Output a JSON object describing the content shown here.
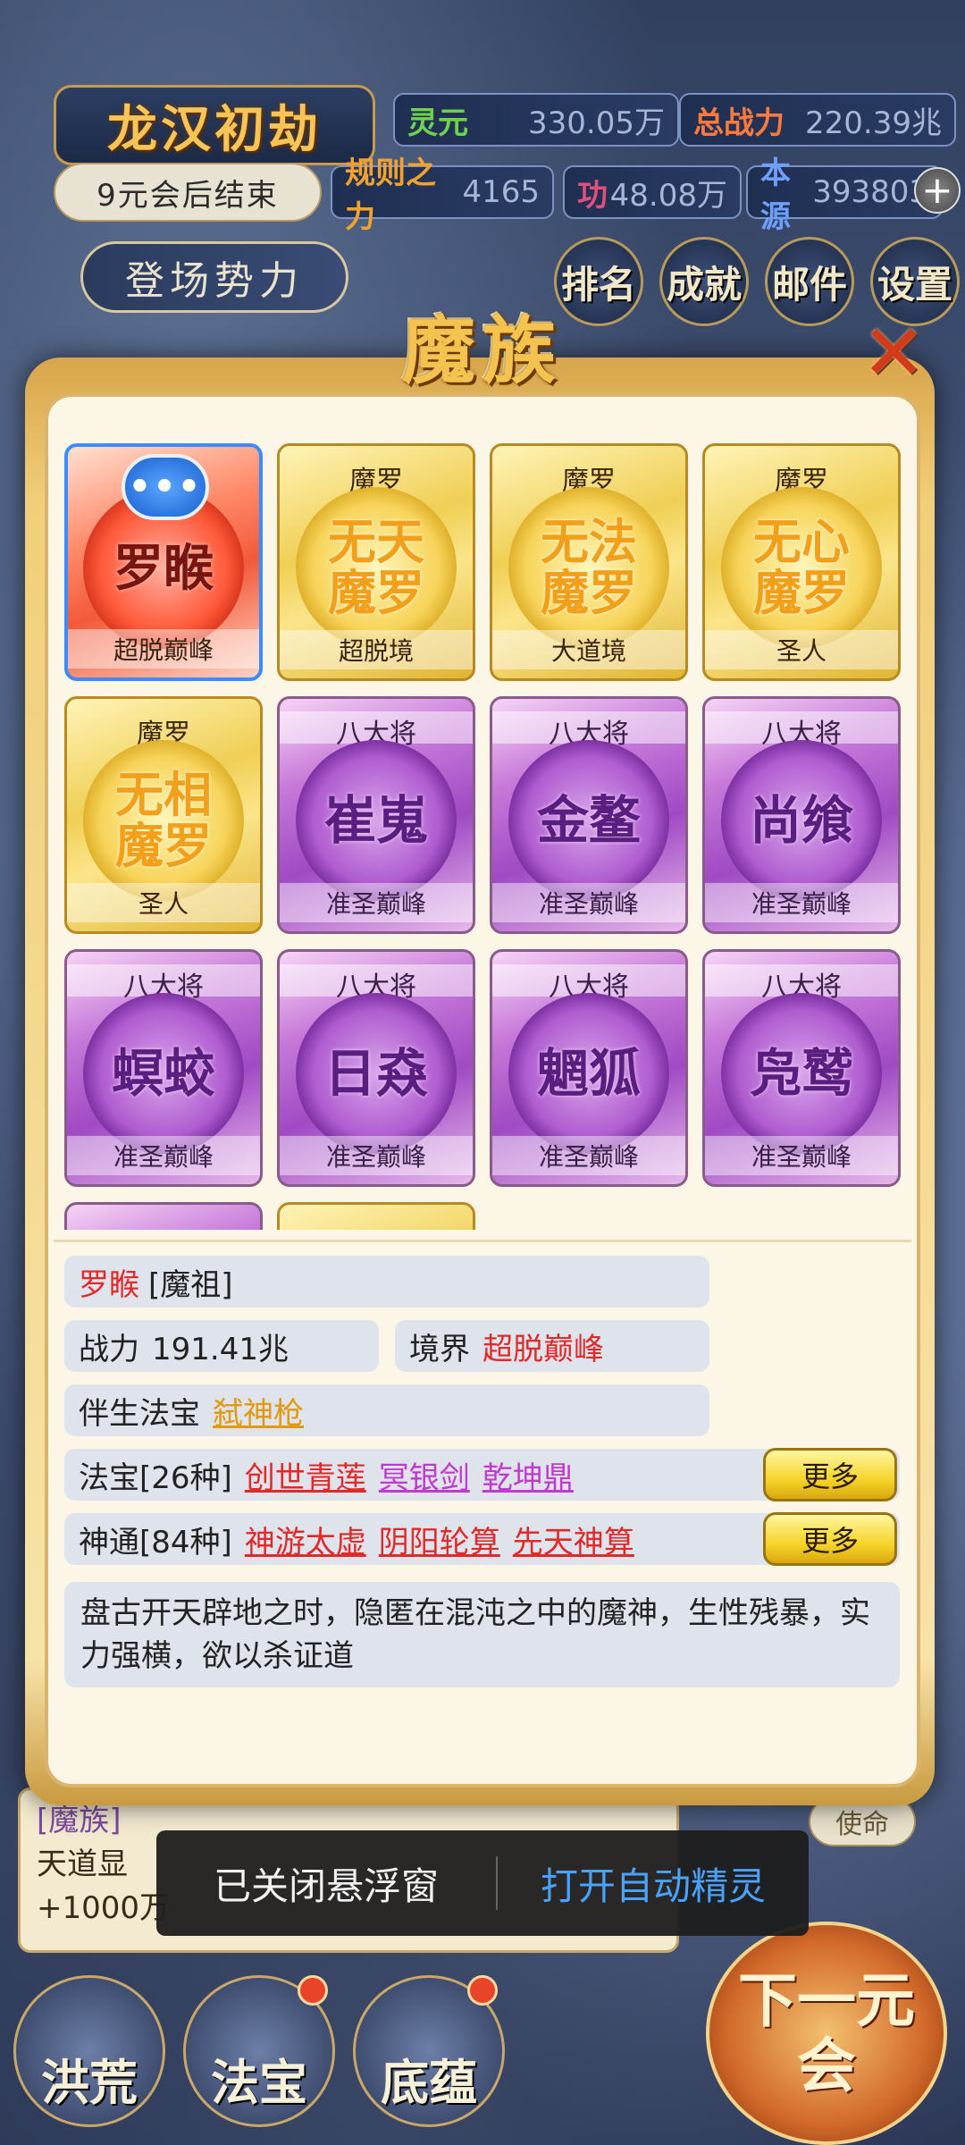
{
  "header": {
    "title": "龙汉初劫",
    "countdown": "9元会后结束",
    "faction_button": "登场势力",
    "stats": {
      "lingyuan_label": "灵元",
      "lingyuan_value": "330.05万",
      "power_label": "总战力",
      "power_value": "220.39兆",
      "rule_label": "规则之力",
      "rule_value": "4165",
      "merit_label": "功",
      "merit_value": "48.08万",
      "origin_label": "本源",
      "origin_value": "393803"
    },
    "plus": "+",
    "nav": [
      "排名",
      "成就",
      "邮件",
      "设置"
    ]
  },
  "modal": {
    "title": "魔族",
    "close": "✕",
    "cards": [
      {
        "rank": "",
        "name": "罗睺",
        "realm": "超脱巅峰",
        "style": "red",
        "bubble": "•••"
      },
      {
        "rank": "魔罗",
        "name": "无天魔罗",
        "realm": "超脱境",
        "style": "gold"
      },
      {
        "rank": "魔罗",
        "name": "无法魔罗",
        "realm": "大道境",
        "style": "gold"
      },
      {
        "rank": "魔罗",
        "name": "无心魔罗",
        "realm": "圣人",
        "style": "gold"
      },
      {
        "rank": "魔罗",
        "name": "无相魔罗",
        "realm": "圣人",
        "style": "gold"
      },
      {
        "rank": "八大将",
        "name": "崔嵬",
        "realm": "准圣巅峰",
        "style": "purple"
      },
      {
        "rank": "八大将",
        "name": "金鳌",
        "realm": "准圣巅峰",
        "style": "purple"
      },
      {
        "rank": "八大将",
        "name": "尚飨",
        "realm": "准圣巅峰",
        "style": "purple"
      },
      {
        "rank": "八大将",
        "name": "螟蛟",
        "realm": "准圣巅峰",
        "style": "purple"
      },
      {
        "rank": "八大将",
        "name": "日猋",
        "realm": "准圣巅峰",
        "style": "purple"
      },
      {
        "rank": "八大将",
        "name": "魍狐",
        "realm": "准圣巅峰",
        "style": "purple"
      },
      {
        "rank": "八大将",
        "name": "凫鹫",
        "realm": "准圣巅峰",
        "style": "purple"
      }
    ],
    "detail": {
      "name": "罗睺",
      "title": "[魔祖]",
      "power_label": "战力",
      "power_value": "191.41兆",
      "realm_label": "境界",
      "realm_value": "超脱巅峰",
      "companion_label": "伴生法宝",
      "companion_value": "弑神枪",
      "treasures_label": "法宝[26种]",
      "treasures": [
        "创世青莲",
        "冥银剑",
        "乾坤鼎"
      ],
      "skills_label": "神通[84种]",
      "skills": [
        "神游太虚",
        "阴阳轮算",
        "先天神算"
      ],
      "more_label": "更多",
      "description": "盘古开天辟地之时，隐匿在混沌之中的魔神，生性残暴，实力强横，欲以杀证道"
    }
  },
  "background": {
    "log_tag": "[魔族]",
    "log_line1": "天道显",
    "log_line2": "+1000万",
    "use_button": "使命",
    "bottom_nav": [
      "洪荒",
      "法宝",
      "底蕴"
    ],
    "next_button": "下一元会"
  },
  "toast": {
    "message": "已关闭悬浮窗",
    "action": "打开自动精灵"
  }
}
